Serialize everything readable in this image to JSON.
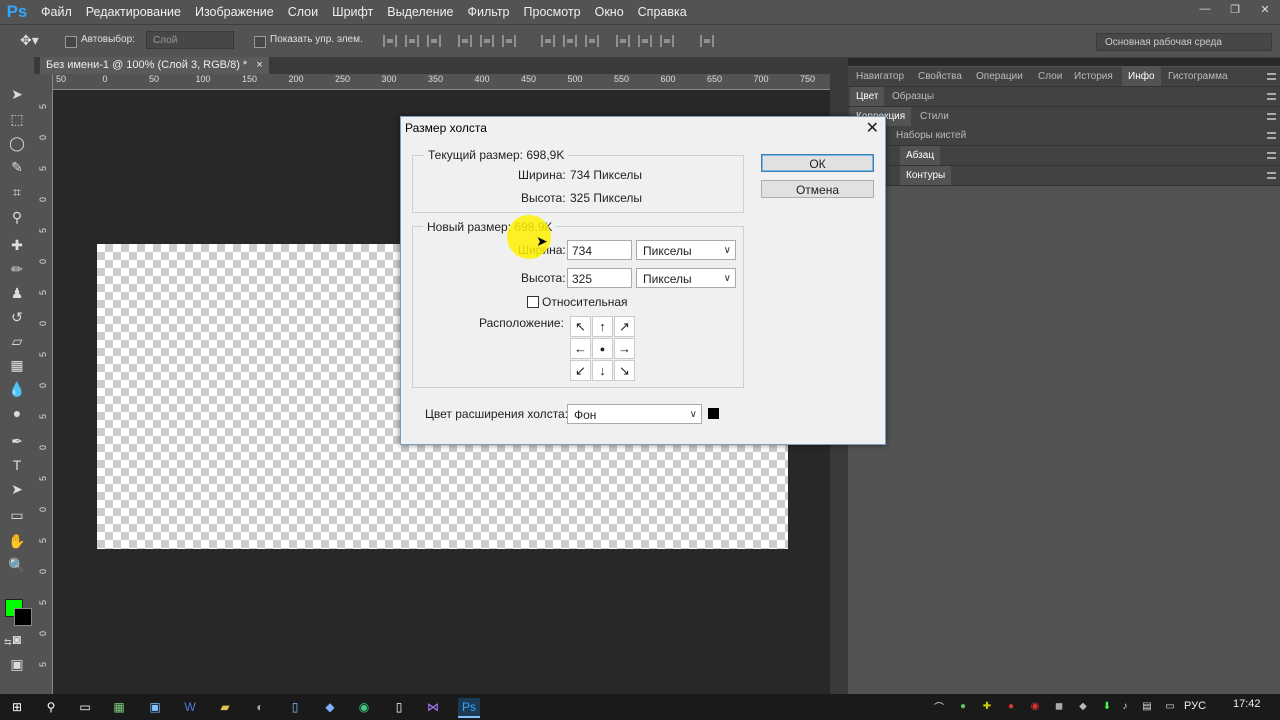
{
  "app": {
    "logo": "Ps"
  },
  "menu": [
    "Файл",
    "Редактирование",
    "Изображение",
    "Слои",
    "Шрифт",
    "Выделение",
    "Фильтр",
    "Просмотр",
    "Окно",
    "Справка"
  ],
  "window_controls": {
    "minimize": "—",
    "restore": "❐",
    "close": "✕"
  },
  "options": {
    "autoselect_label": "Автовыбор:",
    "autoselect_value": "Слой",
    "show_transform_label": "Показать упр. элем.",
    "workspace": "Основная рабочая среда"
  },
  "document": {
    "tab_title": "Без имени-1 @ 100% (Слой 3, RGB/8) *",
    "tab_close": "×",
    "ruler_h": [
      "50",
      "0",
      "50",
      "100",
      "150",
      "200",
      "250",
      "300",
      "350",
      "400",
      "450",
      "500",
      "550",
      "600",
      "650",
      "700",
      "750"
    ],
    "ruler_v": [
      "5",
      "0",
      "5",
      "0",
      "5",
      "0",
      "5",
      "0",
      "5",
      "0",
      "5",
      "0",
      "5",
      "0",
      "5",
      "0",
      "5",
      "0",
      "5"
    ]
  },
  "panels": {
    "row1": [
      "Навигатор",
      "Свойства",
      "Операции",
      "Слои",
      "История",
      "Инфо",
      "Гистограмма"
    ],
    "row1_active": "Инфо",
    "row2": [
      "Цвет",
      "Образцы"
    ],
    "row3": [
      "Коррекция",
      "Стили"
    ],
    "row4": [
      "",
      "Наборы кистей"
    ],
    "row5": [
      "",
      "Абзац"
    ],
    "row6": [
      "",
      "Контуры"
    ]
  },
  "dialog": {
    "title": "Размер холста",
    "close": "✕",
    "current_size_label": "Текущий размер:",
    "current_size_value": "698,9K",
    "current_width_label": "Ширина:",
    "current_width_value": "734 Пикселы",
    "current_height_label": "Высота:",
    "current_height_value": "325 Пикселы",
    "new_size_label": "Новый размер:",
    "new_size_value": "698,9K",
    "width_label": "Ширина:",
    "width_value": "734",
    "width_unit": "Пикселы",
    "height_label": "Высота:",
    "height_value": "325",
    "height_unit": "Пикселы",
    "relative_label": "Относительная",
    "anchor_label": "Расположение:",
    "anchor_arrows": [
      "↖",
      "↑",
      "↗",
      "←",
      "●",
      "→",
      "↙",
      "↓",
      "↘"
    ],
    "extension_color_label": "Цвет расширения холста:",
    "extension_color_value": "Фон",
    "extension_swatch": "#000000",
    "ok_label": "ОК",
    "cancel_label": "Отмена"
  },
  "colors": {
    "foreground": "#00ff00",
    "background": "#000000",
    "accent": "#30a8ff"
  },
  "taskbar": {
    "language": "РУС",
    "time": "17:42"
  }
}
